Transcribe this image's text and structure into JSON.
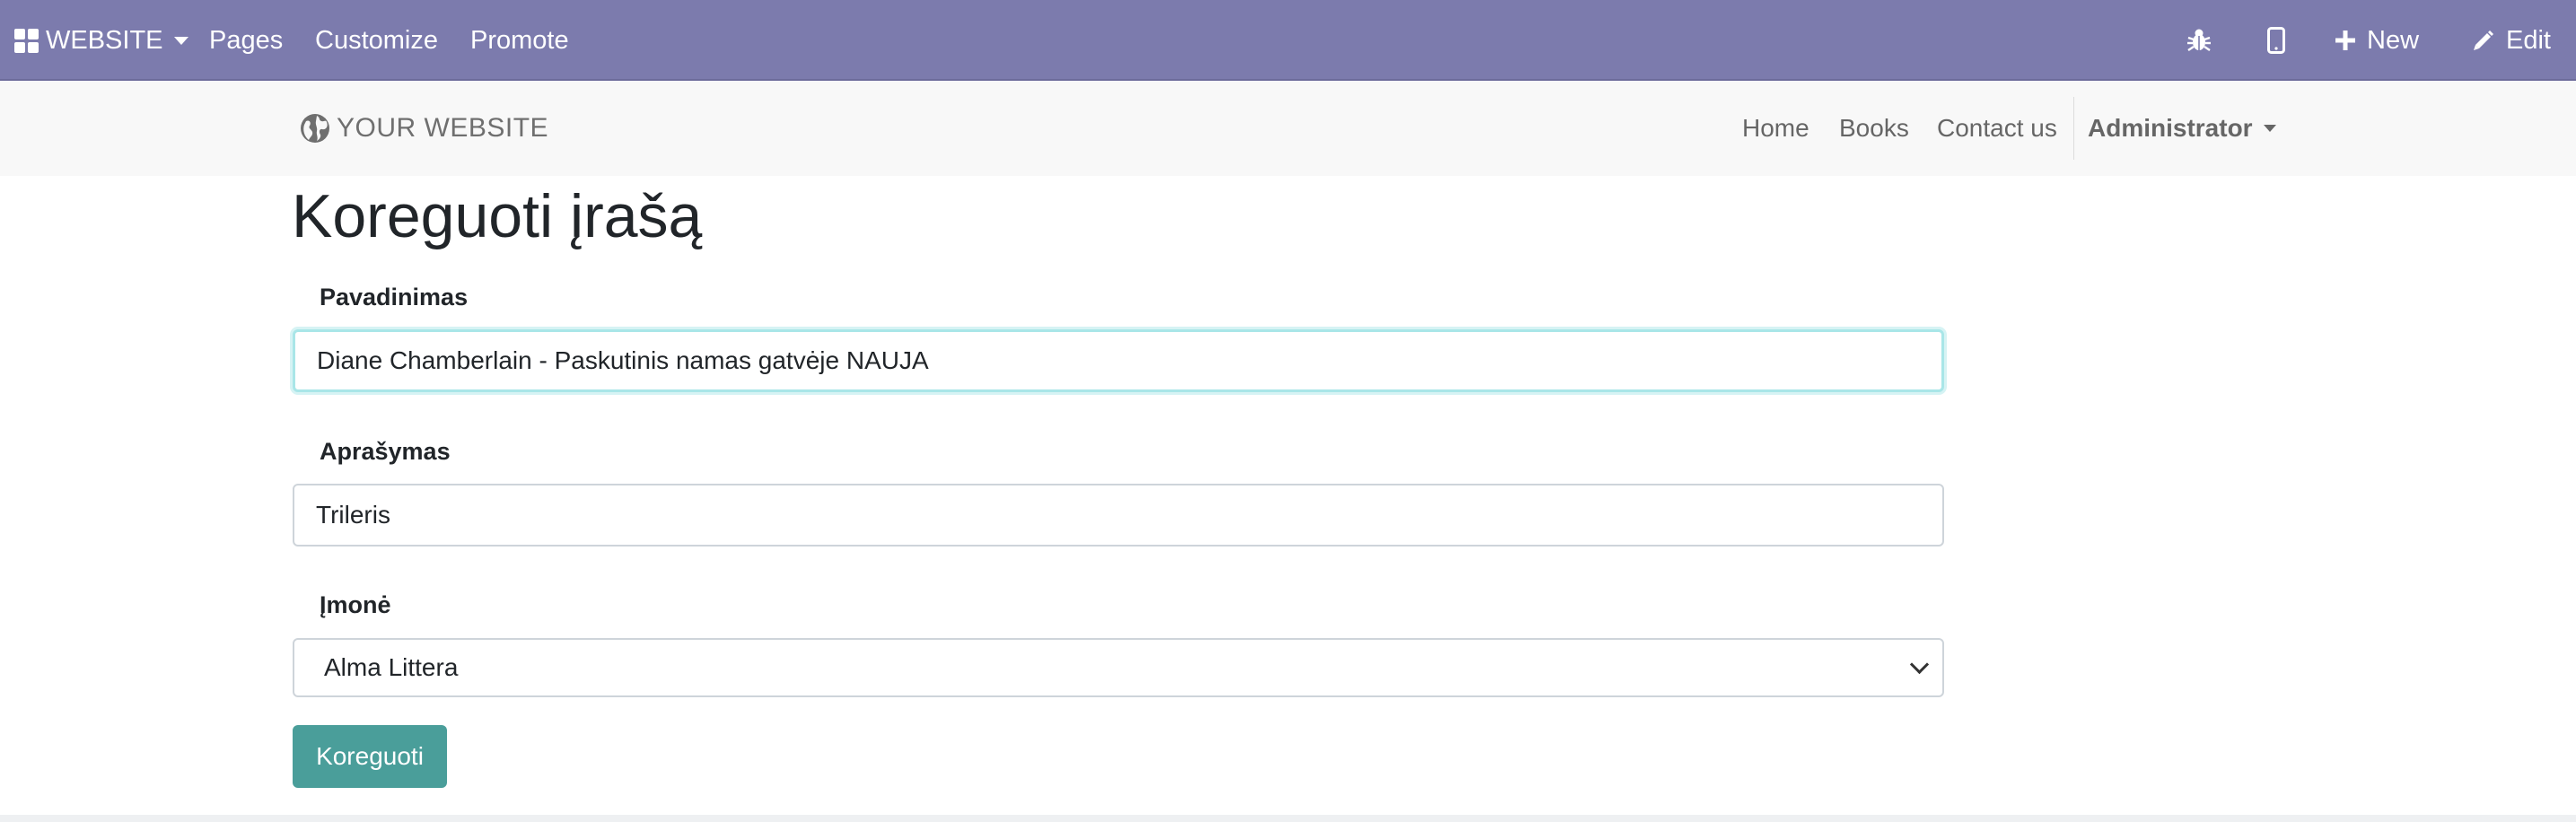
{
  "adminbar": {
    "app_label": "WEBSITE",
    "menu": [
      "Pages",
      "Customize",
      "Promote"
    ],
    "new_label": "New",
    "edit_label": "Edit"
  },
  "navbar": {
    "logo_text": "YOUR WEBSITE",
    "links": [
      "Home",
      "Books",
      "Contact us"
    ],
    "user": "Administrator"
  },
  "page": {
    "title": "Koreguoti įrašą"
  },
  "form": {
    "name_label": "Pavadinimas",
    "name_value": "Diane Chamberlain - Paskutinis namas gatvėje NAUJA",
    "description_label": "Aprašymas",
    "description_value": "Trileris",
    "company_label": "Įmonė",
    "company_value": "Alma Littera",
    "submit_label": "Koreguoti"
  },
  "colors": {
    "adminbar_bg": "#7c7bad",
    "primary_button": "#4a9e9a",
    "focus_ring": "#a9e6e8"
  }
}
